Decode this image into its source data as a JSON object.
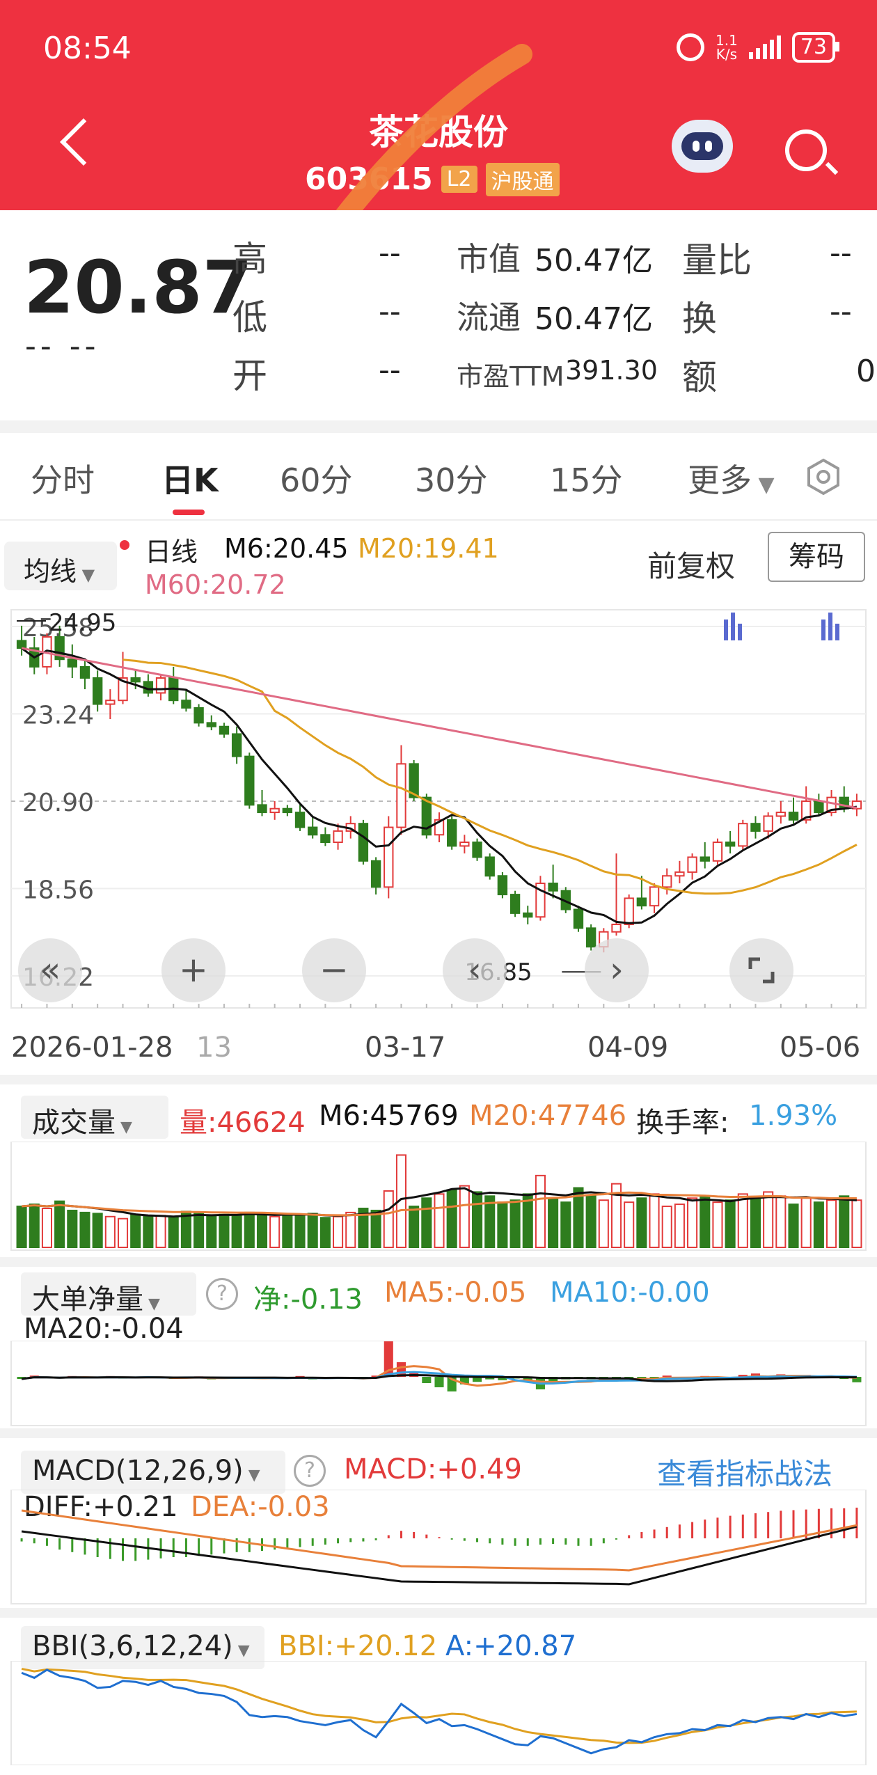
{
  "status_bar": {
    "time": "08:54",
    "net_speed_top": "1.1",
    "net_speed_bottom": "K/s",
    "battery": "73"
  },
  "header": {
    "stock_name": "茶花股份",
    "stock_code": "603615",
    "tag_l2": "L2",
    "tag_connect": "沪股通"
  },
  "quote": {
    "price": "20.87",
    "change": "-- --",
    "high_label": "高",
    "high_value": "--",
    "low_label": "低",
    "low_value": "--",
    "open_label": "开",
    "open_value": "--",
    "mktcap_label": "市值",
    "mktcap_value": "50.47亿",
    "float_label": "流通",
    "float_value": "50.47亿",
    "pe_label": "市盈TTM",
    "pe_value": "391.30",
    "vol_ratio_label": "量比",
    "vol_ratio_value": "--",
    "turnover_label": "换",
    "turnover_value": "--",
    "amount_label": "额",
    "amount_value": "0"
  },
  "tabs": [
    "分时",
    "日K",
    "60分",
    "30分",
    "15分",
    "更多"
  ],
  "kline_legend": {
    "selector": "均线",
    "daily": "日线",
    "m6": "M6:20.45",
    "m20": "M20:19.41",
    "m60": "M60:20.72",
    "adjust": "前复权",
    "chips": "筹码"
  },
  "kline_axis": {
    "y_labels": [
      "25.58",
      "23.24",
      "20.90",
      "18.56",
      "16.22"
    ],
    "high_marker": "24.95",
    "low_marker": "16.85",
    "dates": [
      "2026-01-28",
      "13",
      "03-17",
      "04-09",
      "05-06"
    ]
  },
  "controls": [
    "«",
    "+",
    "−",
    "‹",
    "›"
  ],
  "volume": {
    "selector": "成交量",
    "vol": "量:46624",
    "m6": "M6:45769",
    "m20": "M20:47746",
    "turnover_label": "换手率:",
    "turnover_value": "1.93%"
  },
  "bigorder": {
    "selector": "大单净量",
    "net": "净:-0.13",
    "ma5": "MA5:-0.05",
    "ma10": "MA10:-0.00",
    "ma20": "MA20:-0.04"
  },
  "macd": {
    "selector": "MACD(12,26,9)",
    "macd": "MACD:+0.49",
    "link": "查看指标战法",
    "diff": "DIFF:+0.21",
    "dea": "DEA:-0.03"
  },
  "bbi": {
    "selector": "BBI(3,6,12,24)",
    "bbi": "BBI:+20.12",
    "a": "A:+20.87"
  },
  "colors": {
    "up": "#e23a3a",
    "down": "#2e7d1e",
    "m6": "#111111",
    "m20": "#e0a020",
    "m60": "#e06b84",
    "accent": "#ee3140"
  },
  "chart_data": [
    {
      "type": "candlestick",
      "title": "日线",
      "y_range": [
        16.22,
        25.58
      ],
      "y_ticks": [
        25.58,
        23.24,
        20.9,
        18.56,
        16.22
      ],
      "x_ticks": [
        "2026-01-28",
        "13",
        "03-17",
        "04-09",
        "05-06"
      ],
      "last_close": 20.87,
      "period_high": 24.95,
      "period_low": 16.85,
      "ohlc": [
        [
          25.2,
          25.6,
          24.8,
          25.0
        ],
        [
          25.0,
          25.3,
          24.3,
          24.5
        ],
        [
          24.5,
          25.4,
          24.3,
          25.3
        ],
        [
          25.3,
          25.6,
          24.5,
          24.7
        ],
        [
          24.7,
          25.1,
          24.2,
          24.5
        ],
        [
          24.5,
          24.7,
          23.9,
          24.2
        ],
        [
          24.2,
          24.4,
          23.3,
          23.5
        ],
        [
          23.5,
          23.9,
          23.1,
          23.6
        ],
        [
          23.6,
          24.9,
          23.5,
          24.2
        ],
        [
          24.2,
          24.4,
          23.9,
          24.1
        ],
        [
          24.1,
          24.3,
          23.7,
          23.8
        ],
        [
          23.8,
          24.3,
          23.6,
          24.2
        ],
        [
          24.2,
          24.5,
          23.5,
          23.6
        ],
        [
          23.6,
          23.9,
          23.3,
          23.4
        ],
        [
          23.4,
          23.5,
          22.9,
          23.0
        ],
        [
          23.0,
          23.2,
          22.8,
          22.9
        ],
        [
          22.9,
          23.0,
          22.6,
          22.7
        ],
        [
          22.7,
          22.9,
          21.9,
          22.1
        ],
        [
          22.1,
          22.2,
          20.7,
          20.8
        ],
        [
          20.8,
          21.2,
          20.5,
          20.6
        ],
        [
          20.6,
          20.9,
          20.4,
          20.7
        ],
        [
          20.7,
          20.8,
          20.5,
          20.6
        ],
        [
          20.6,
          20.8,
          20.1,
          20.2
        ],
        [
          20.2,
          20.5,
          19.9,
          20.0
        ],
        [
          20.0,
          20.2,
          19.7,
          19.8
        ],
        [
          19.8,
          20.3,
          19.6,
          20.1
        ],
        [
          20.1,
          20.5,
          19.9,
          20.3
        ],
        [
          20.3,
          20.4,
          19.2,
          19.3
        ],
        [
          19.3,
          19.4,
          18.4,
          18.6
        ],
        [
          18.6,
          20.5,
          18.3,
          20.2
        ],
        [
          20.2,
          22.4,
          20.0,
          21.9
        ],
        [
          21.9,
          22.0,
          20.9,
          21.0
        ],
        [
          21.0,
          21.1,
          19.9,
          20.0
        ],
        [
          20.0,
          20.6,
          19.8,
          20.4
        ],
        [
          20.4,
          20.5,
          19.6,
          19.7
        ],
        [
          19.7,
          20.0,
          19.5,
          19.8
        ],
        [
          19.8,
          19.9,
          19.3,
          19.4
        ],
        [
          19.4,
          19.5,
          18.8,
          18.9
        ],
        [
          18.9,
          19.0,
          18.3,
          18.4
        ],
        [
          18.4,
          18.5,
          17.8,
          17.9
        ],
        [
          17.9,
          18.1,
          17.6,
          17.8
        ],
        [
          17.8,
          18.9,
          17.7,
          18.7
        ],
        [
          18.7,
          19.2,
          18.3,
          18.5
        ],
        [
          18.5,
          18.6,
          17.9,
          18.0
        ],
        [
          18.0,
          18.1,
          17.4,
          17.5
        ],
        [
          17.5,
          17.6,
          16.9,
          17.0
        ],
        [
          17.0,
          17.5,
          16.85,
          17.4
        ],
        [
          17.4,
          19.5,
          17.3,
          17.6
        ],
        [
          17.6,
          18.4,
          17.5,
          18.3
        ],
        [
          18.3,
          18.9,
          18.0,
          18.1
        ],
        [
          18.1,
          18.7,
          17.9,
          18.6
        ],
        [
          18.6,
          19.1,
          18.4,
          18.9
        ],
        [
          18.9,
          19.3,
          18.7,
          19.0
        ],
        [
          19.0,
          19.5,
          18.8,
          19.4
        ],
        [
          19.4,
          19.8,
          19.1,
          19.3
        ],
        [
          19.3,
          19.9,
          19.2,
          19.8
        ],
        [
          19.8,
          20.1,
          19.5,
          19.7
        ],
        [
          19.7,
          20.4,
          19.6,
          20.3
        ],
        [
          20.3,
          20.5,
          19.9,
          20.1
        ],
        [
          20.1,
          20.6,
          19.9,
          20.5
        ],
        [
          20.5,
          20.9,
          20.3,
          20.6
        ],
        [
          20.6,
          21.0,
          20.3,
          20.4
        ],
        [
          20.4,
          21.3,
          20.3,
          20.9
        ],
        [
          20.9,
          21.1,
          20.5,
          20.6
        ],
        [
          20.6,
          21.2,
          20.5,
          21.0
        ],
        [
          21.0,
          21.3,
          20.6,
          20.7
        ],
        [
          20.7,
          21.1,
          20.5,
          20.9
        ]
      ]
    },
    {
      "type": "bar",
      "title": "成交量",
      "note": "daily volume, red = up day, green = down day",
      "values": [
        40,
        42,
        38,
        45,
        36,
        34,
        33,
        30,
        28,
        32,
        30,
        31,
        29,
        35,
        33,
        30,
        32,
        31,
        34,
        33,
        30,
        32,
        31,
        33,
        29,
        30,
        34,
        38,
        36,
        55,
        90,
        40,
        48,
        52,
        56,
        60,
        54,
        50,
        44,
        46,
        52,
        70,
        48,
        44,
        58,
        50,
        46,
        62,
        44,
        48,
        52,
        40,
        42,
        48,
        50,
        44,
        46,
        52,
        48,
        54,
        50,
        42,
        48,
        44,
        46,
        50,
        46
      ]
    },
    {
      "type": "bar",
      "title": "大单净量",
      "values": [
        -0.05,
        0.03,
        -0.02,
        -0.04,
        0.02,
        -0.03,
        -0.01,
        0.02,
        -0.04,
        -0.02,
        0.01,
        -0.03,
        -0.05,
        -0.02,
        0.01,
        -0.06,
        -0.03,
        -0.02,
        -0.04,
        -0.01,
        -0.05,
        -0.03,
        0.02,
        -0.06,
        -0.04,
        -0.02,
        -0.03,
        -0.05,
        0.03,
        0.85,
        0.35,
        0.1,
        -0.15,
        -0.25,
        -0.35,
        -0.18,
        -0.12,
        -0.06,
        -0.08,
        -0.04,
        -0.1,
        -0.3,
        -0.1,
        -0.06,
        -0.04,
        -0.06,
        -0.1,
        -0.03,
        -0.05,
        -0.02,
        -0.04,
        0.03,
        -0.02,
        -0.04,
        0.02,
        -0.03,
        -0.05,
        0.05,
        0.08,
        -0.02,
        0.06,
        -0.04,
        0.05,
        -0.02,
        0.03,
        -0.05,
        -0.13
      ]
    },
    {
      "type": "bar",
      "title": "MACD(12,26,9)",
      "values": [
        -0.05,
        -0.08,
        -0.12,
        -0.18,
        -0.22,
        -0.26,
        -0.3,
        -0.33,
        -0.36,
        -0.36,
        -0.34,
        -0.32,
        -0.3,
        -0.3,
        -0.28,
        -0.26,
        -0.24,
        -0.22,
        -0.22,
        -0.2,
        -0.18,
        -0.16,
        -0.14,
        -0.12,
        -0.1,
        -0.08,
        -0.06,
        -0.05,
        -0.03,
        0.05,
        0.12,
        0.1,
        0.06,
        0.02,
        -0.02,
        -0.04,
        -0.06,
        -0.08,
        -0.1,
        -0.12,
        -0.12,
        -0.1,
        -0.09,
        -0.1,
        -0.12,
        -0.12,
        -0.08,
        -0.02,
        0.05,
        0.1,
        0.14,
        0.18,
        0.22,
        0.26,
        0.3,
        0.33,
        0.36,
        0.38,
        0.4,
        0.42,
        0.44,
        0.45,
        0.46,
        0.47,
        0.48,
        0.48,
        0.49
      ]
    }
  ]
}
